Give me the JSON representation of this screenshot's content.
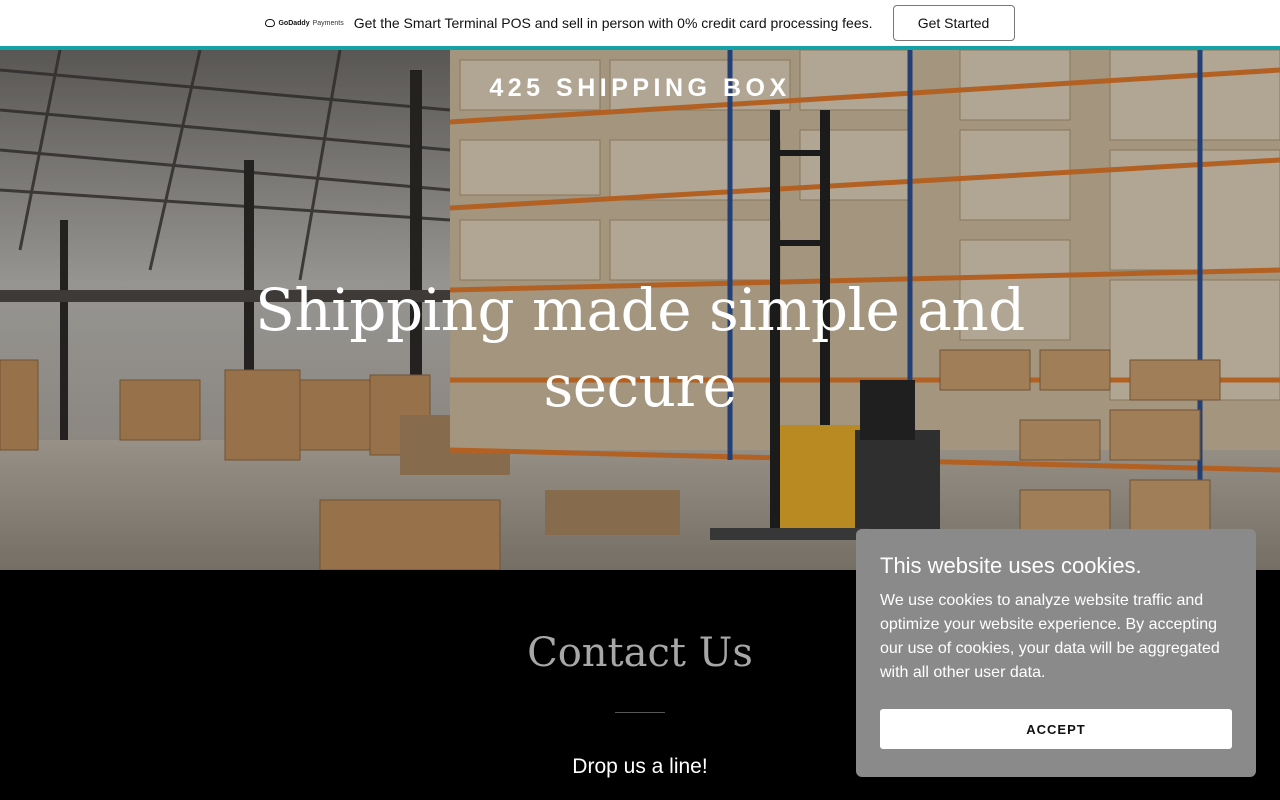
{
  "promo": {
    "logo_brand": "GoDaddy",
    "logo_suffix": "Payments",
    "text": "Get the Smart Terminal POS and sell in person with 0% credit card processing fees.",
    "button_label": "Get Started",
    "accent_color": "#16a2a5"
  },
  "hero": {
    "site_title": "425 SHIPPING BOX",
    "heading": "Shipping made simple and secure"
  },
  "contact": {
    "title": "Contact Us",
    "subtitle": "Drop us a line!"
  },
  "cookie_banner": {
    "title": "This website uses cookies.",
    "body": "We use cookies to analyze website traffic and optimize your website experience. By accepting our use of cookies, your data will be aggregated with all other user data.",
    "accept_label": "ACCEPT"
  }
}
